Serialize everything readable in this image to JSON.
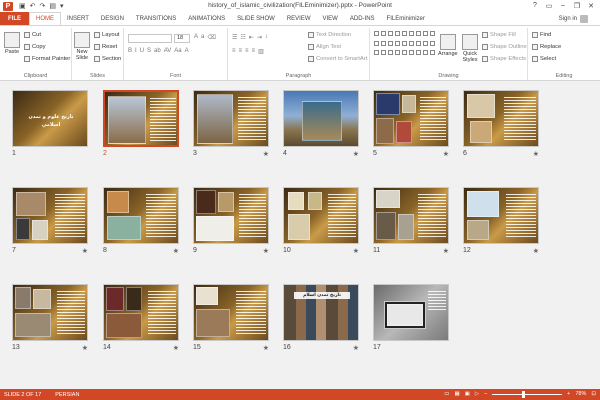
{
  "app": {
    "title": "history_of_islamic_civilization(FILEminimizer).pptx - PowerPoint",
    "logo_letter": "P",
    "qat_icons": [
      "save-icon",
      "undo-icon",
      "redo-icon",
      "slideshow-icon",
      "customize-icon"
    ],
    "window_controls": [
      "?",
      "▭",
      "–",
      "❐",
      "✕"
    ]
  },
  "tabs": [
    "FILE",
    "HOME",
    "INSERT",
    "DESIGN",
    "TRANSITIONS",
    "ANIMATIONS",
    "SLIDE SHOW",
    "REVIEW",
    "VIEW",
    "ADD-INS",
    "FILEminimizer"
  ],
  "active_tab": "HOME",
  "signin": "Sign in",
  "ribbon": {
    "clipboard": {
      "label": "Clipboard",
      "paste": "Paste",
      "cut": "Cut",
      "copy": "Copy",
      "format_painter": "Format Painter"
    },
    "slides": {
      "label": "Slides",
      "new_slide": "New",
      "new_slide_2": "Slide",
      "layout": "Layout",
      "reset": "Reset",
      "section": "Section"
    },
    "font": {
      "label": "Font",
      "size": "18"
    },
    "paragraph": {
      "label": "Paragraph",
      "text_direction": "Text Direction",
      "align_text": "Align Text",
      "convert_smartart": "Convert to SmartArt"
    },
    "drawing": {
      "label": "Drawing",
      "arrange": "Arrange",
      "quick_styles": "Quick",
      "quick_styles_2": "Styles",
      "shape_fill": "Shape Fill",
      "shape_outline": "Shape Outline",
      "shape_effects": "Shape Effects"
    },
    "editing": {
      "label": "Editing",
      "find": "Find",
      "replace": "Replace",
      "select": "Select"
    }
  },
  "slides": [
    {
      "num": "1",
      "title_overlay": "تاريخ علوم و تمدن اسلامي"
    },
    {
      "num": "2"
    },
    {
      "num": "3"
    },
    {
      "num": "4"
    },
    {
      "num": "5"
    },
    {
      "num": "6"
    },
    {
      "num": "7"
    },
    {
      "num": "8"
    },
    {
      "num": "9"
    },
    {
      "num": "10"
    },
    {
      "num": "11"
    },
    {
      "num": "12"
    },
    {
      "num": "13"
    },
    {
      "num": "14"
    },
    {
      "num": "15"
    },
    {
      "num": "16",
      "title_overlay": "تاریخ تمدن اسلام"
    },
    {
      "num": "17"
    }
  ],
  "selected_slide": "2",
  "transition_star": "★",
  "status": {
    "slide_info": "SLIDE 2 OF 17",
    "language": "PERSIAN",
    "zoom": "78%"
  },
  "colors": {
    "accent": "#d24726"
  }
}
